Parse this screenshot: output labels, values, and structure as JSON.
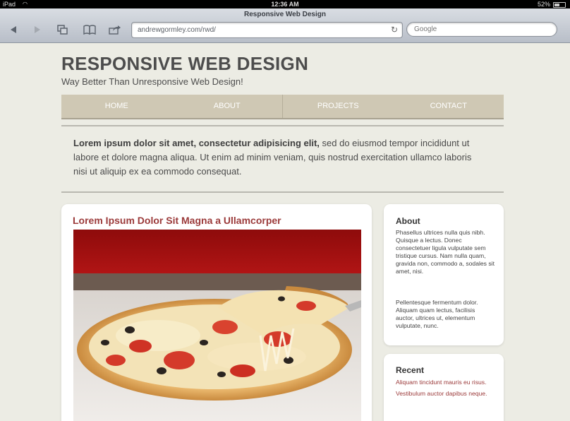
{
  "status_bar": {
    "device": "iPad",
    "time": "12:36 AM",
    "battery": "52%"
  },
  "browser": {
    "page_title": "Responsive Web Design",
    "url": "andrewgormley.com/rwd/",
    "search_placeholder": "Google",
    "icons": {
      "back": "back-arrow-icon",
      "forward": "forward-arrow-icon",
      "tabs": "pages-icon",
      "bookmarks": "bookmarks-icon",
      "share": "share-icon",
      "reload": "reload-icon"
    }
  },
  "site": {
    "title": "RESPONSIVE WEB DESIGN",
    "tagline": "Way Better Than Unresponsive Web Design!",
    "nav": [
      "HOME",
      "ABOUT",
      "PROJECTS",
      "CONTACT"
    ],
    "intro_bold": "Lorem ipsum dolor sit amet, consectetur adipisicing elit,",
    "intro_rest": " sed do eiusmod tempor incididunt ut labore et dolore magna aliqua. Ut enim ad minim veniam, quis nostrud exercitation ullamco laboris nisi ut aliquip ex ea commodo consequat.",
    "article_title": "Lorem Ipsum Dolor Sit Magna a Ullamcorper",
    "about": {
      "heading": "About",
      "para1": "Phasellus ultrices nulla quis nibh. Quisque a lectus. Donec consectetuer ligula vulputate sem tristique cursus. Nam nulla quam, gravida non, commodo a, sodales sit amet, nisi.",
      "para2": "Pellentesque fermentum dolor. Aliquam quam lectus, facilisis auctor, ultrices ut, elementum vulputate, nunc."
    },
    "recent": {
      "heading": "Recent",
      "links": [
        "Aliquam tincidunt mauris eu risus.",
        "Vestibulum auctor dapibus neque."
      ]
    }
  },
  "colors": {
    "accent": "#9b3a3a",
    "nav_bg": "#cfc8b4",
    "page_bg": "#ecece4"
  }
}
